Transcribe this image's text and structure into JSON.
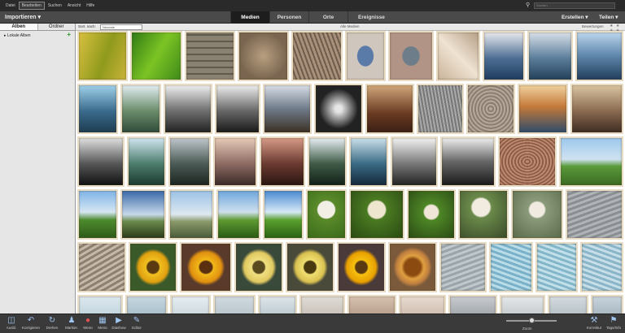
{
  "menu": {
    "items": [
      "Datei",
      "Bearbeiten",
      "Suchen",
      "Ansicht",
      "Hilfe"
    ]
  },
  "search": {
    "placeholder": "Suchen"
  },
  "toolbar": {
    "import_label": "Importieren",
    "tabs": [
      "Medien",
      "Personen",
      "Orte",
      "Ereignisse"
    ],
    "create_label": "Erstellen",
    "share_label": "Teilen"
  },
  "left": {
    "tabs": [
      "Alben",
      "Ordner"
    ],
    "plus": "+",
    "local_albums": "Lokale Alben"
  },
  "sortbar": {
    "sort_label": "Sort. nach:",
    "sort_value": "Neueste",
    "all_media": "Alle Medien",
    "rating_label": "Bewertungen",
    "stars": "★ ★ ★ ★ ★"
  },
  "bottom": {
    "buttons": [
      "Ausbl.",
      "Korrigieren",
      "Drehen",
      "Markier.",
      "Menü",
      "Menü",
      "Diashow",
      "Editor"
    ],
    "zoom_label": "Zoom",
    "right_buttons": [
      "Korrektur",
      "Tags/Info"
    ]
  },
  "colors": {
    "accent": "#9ec5f0",
    "panel": "#e6e6e6",
    "toolbar": "#4a4a4a",
    "plus": "#2a9a2a"
  }
}
